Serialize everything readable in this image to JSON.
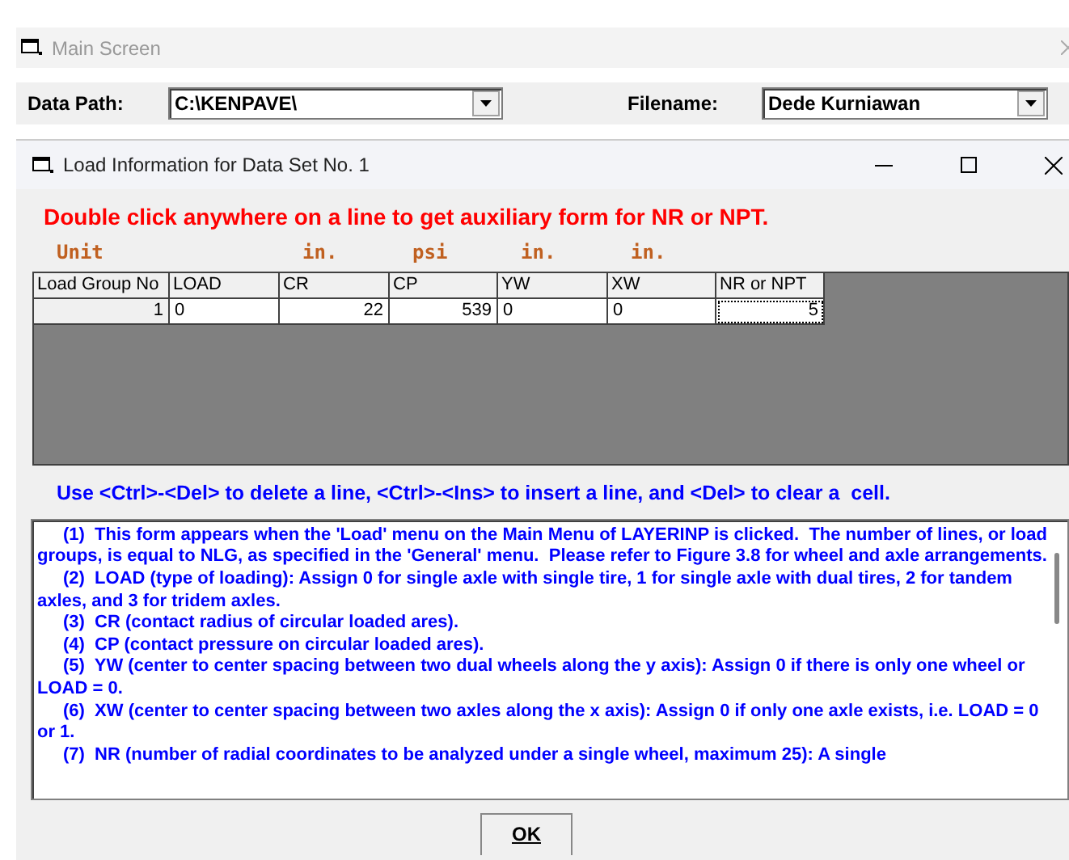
{
  "main_window": {
    "title": "Main Screen"
  },
  "toolbar": {
    "data_path": {
      "label": "Data Path:",
      "value": "C:\\KENPAVE\\"
    },
    "filename": {
      "label": "Filename:",
      "value": "Dede Kurniawan"
    }
  },
  "dialog": {
    "title": "Load Information for Data Set No. 1",
    "instruction": "Double click anywhere on a line to get auxiliary form for NR or NPT.",
    "unit_label": "Unit",
    "columns": [
      {
        "label": "Load Group No"
      },
      {
        "label": "LOAD"
      },
      {
        "label": "CR",
        "unit": "in."
      },
      {
        "label": "CP",
        "unit": "psi"
      },
      {
        "label": "YW",
        "unit": "in."
      },
      {
        "label": "XW",
        "unit": "in."
      },
      {
        "label": "NR or NPT"
      }
    ],
    "rows": [
      {
        "cells": [
          {
            "text": "1",
            "focused": false
          },
          {
            "text": "0",
            "focused": false
          },
          {
            "text": "22",
            "focused": false
          },
          {
            "text": "539",
            "focused": false
          },
          {
            "text": "0",
            "focused": false
          },
          {
            "text": "0",
            "focused": false
          },
          {
            "text": "5",
            "focused": true
          }
        ]
      }
    ],
    "keys_hint": "Use <Ctrl>-<Del> to delete a line, <Ctrl>-<Ins> to insert a line, and <Del> to clear a  cell.",
    "help": [
      "(1)  This form appears when the 'Load' menu on the Main Menu of LAYERINP is clicked.  The number of lines, or load groups, is equal to NLG, as specified in the 'General' menu.  Please refer to Figure 3.8 for wheel and axle arrangements.",
      "(2)  LOAD (type of loading): Assign 0 for single axle with single tire, 1 for single axle with dual tires, 2 for tandem axles, and 3 for tridem axles.",
      "(3)  CR (contact radius of circular loaded ares).",
      "(4)  CP (contact pressure on circular loaded ares).",
      "(5)  YW (center to center spacing between two dual wheels along the y axis): Assign 0 if there is only one wheel or LOAD = 0.",
      "(6)  XW (center to center spacing between two axles along the x axis): Assign 0 if only one axle exists, i.e. LOAD = 0 or 1.",
      "(7)  NR (number of radial coordinates to be analyzed under a single wheel, maximum 25): A single"
    ],
    "ok_button": "OK"
  }
}
